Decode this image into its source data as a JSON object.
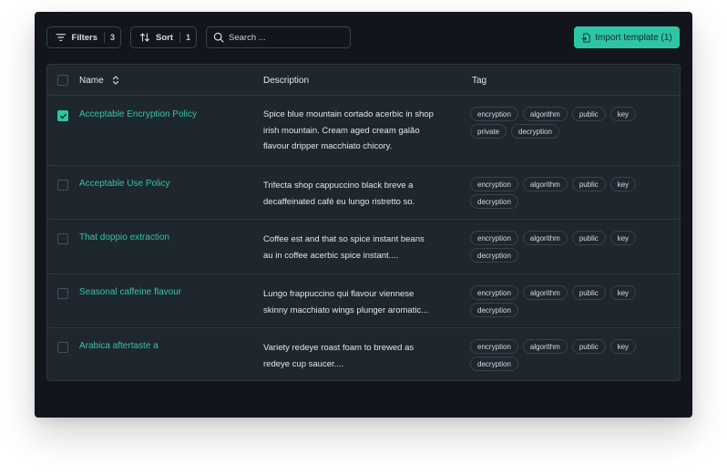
{
  "toolbar": {
    "filters_label": "Filters",
    "filters_count": "3",
    "sort_label": "Sort",
    "sort_count": "1",
    "search_placeholder": "Search ...",
    "import_label": "Import template (1)"
  },
  "colors": {
    "accent": "#2ec5a6",
    "window_bg": "#12161c",
    "table_bg": "#1e262e"
  },
  "table": {
    "headers": {
      "name": "Name",
      "description": "Description",
      "tag": "Tag"
    },
    "rows": [
      {
        "checked": true,
        "name": "Acceptable Encryption Policy",
        "desc_lines": [
          "Spice blue mountain cortado acerbic in shop",
          "irish mountain. Cream aged cream galão",
          "flavour dripper macchiato chicory."
        ],
        "tags": [
          "encryption",
          "algorithm",
          "public",
          "key",
          "private",
          "decryption"
        ]
      },
      {
        "checked": false,
        "name": "Acceptable Use Policy",
        "desc_lines": [
          "Trifecta shop cappuccino black breve a",
          "decaffeinated café eu lungo ristretto so."
        ],
        "tags": [
          "encryption",
          "algorithm",
          "public",
          "key",
          "decryption"
        ]
      },
      {
        "checked": false,
        "name": "That doppio extraction",
        "desc_lines": [
          "Coffee est and that so spice instant beans",
          "au in coffee acerbic spice instant...."
        ],
        "tags": [
          "encryption",
          "algorithm",
          "public",
          "key",
          "decryption"
        ]
      },
      {
        "checked": false,
        "name": "Seasonal caffeine flavour",
        "desc_lines": [
          "Lungo frappuccino qui flavour viennese",
          "skinny macchiato wings plunger aromatic..."
        ],
        "tags": [
          "encryption",
          "algorithm",
          "public",
          "key",
          "decryption"
        ]
      },
      {
        "checked": false,
        "name": "Arabica aftertaste a",
        "desc_lines": [
          "Variety redeye roast foam to brewed as",
          "redeye cup saucer...."
        ],
        "tags": [
          "encryption",
          "algorithm",
          "public",
          "key",
          "decryption"
        ]
      }
    ]
  }
}
